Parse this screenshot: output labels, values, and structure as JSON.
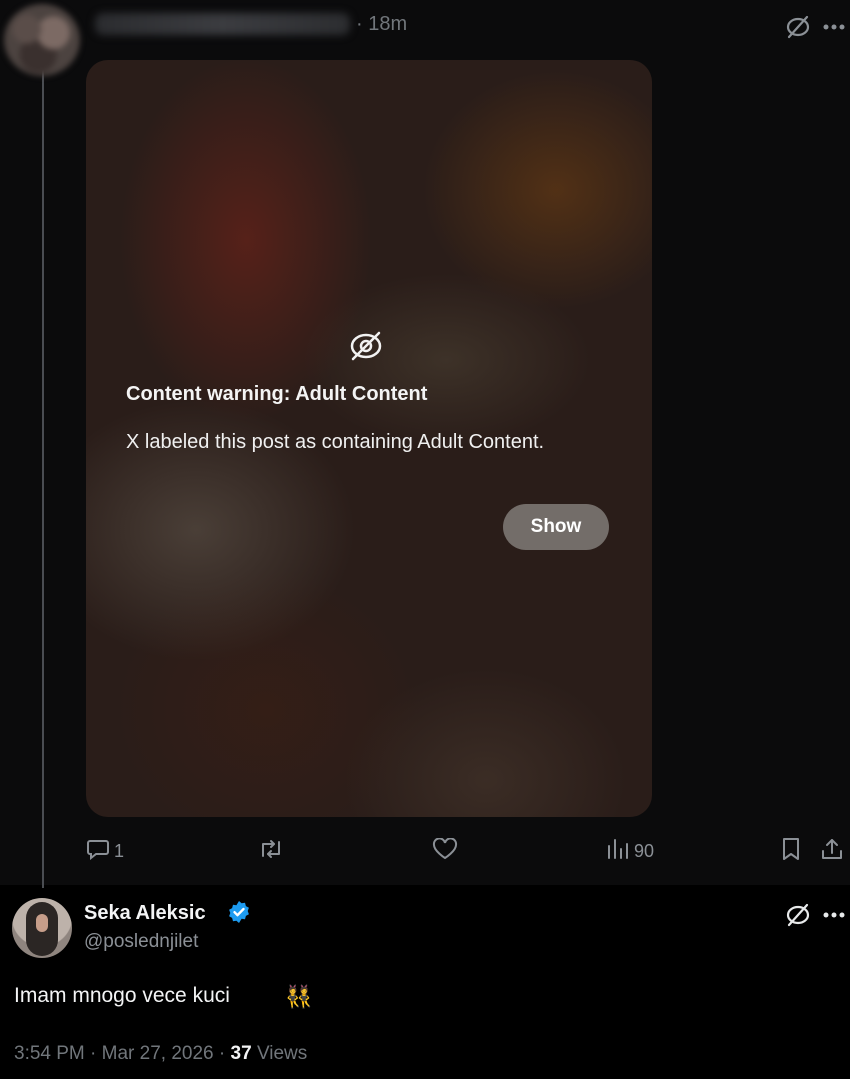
{
  "top_post": {
    "author_name": "",
    "timestamp": "· 18m",
    "content_warning": {
      "title": "Content warning: Adult Content",
      "description": "X labeled this post as containing Adult Content.",
      "show_button": "Show"
    },
    "actions": {
      "reply_count": "1",
      "retweet_count": "",
      "like_count": "",
      "views_count": "90"
    }
  },
  "reply_post": {
    "display_name": "Seka Aleksic",
    "handle": "@poslednjilet",
    "text": "Imam mnogo vece kuci",
    "emoji": "👯",
    "time": "3:54 PM",
    "separator": "·",
    "date": "Mar 27, 2026",
    "views_count": "37",
    "views_label": "Views"
  },
  "colors": {
    "background_top": "#0b0b0c",
    "background_bottom": "#000000",
    "verified_badge": "#1d9bf0",
    "muted_text": "#71767b"
  },
  "icons": [
    "eye-slash-icon",
    "more-icon",
    "reply-icon",
    "retweet-icon",
    "like-icon",
    "views-icon",
    "bookmark-icon",
    "share-icon",
    "verified-badge-icon"
  ]
}
